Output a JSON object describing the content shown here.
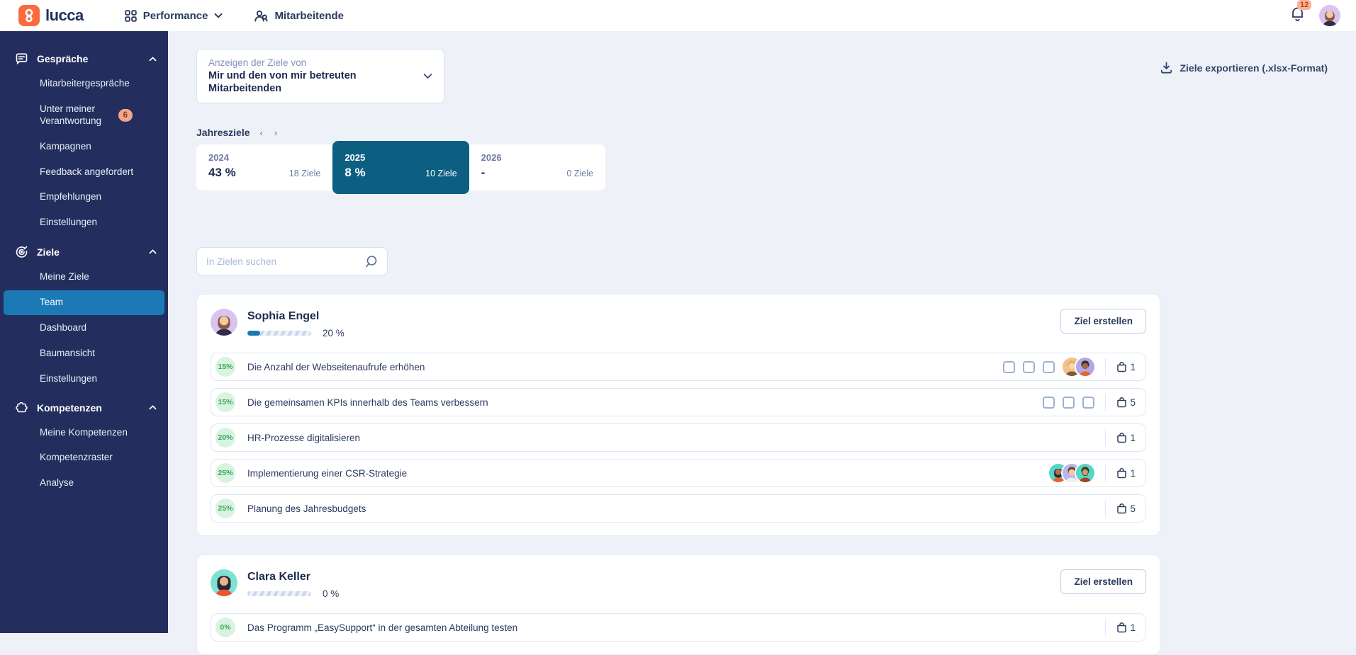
{
  "topbar": {
    "brand": "lucca",
    "app_switcher": "Performance",
    "nav_people": "Mitarbeitende",
    "notifications": "12"
  },
  "sidebar": {
    "sections": [
      {
        "label": "Gespräche",
        "icon": "chat-icon",
        "items": [
          {
            "label": "Mitarbeitergespräche"
          },
          {
            "label": "Unter meiner Verantwortung",
            "badge": "6"
          },
          {
            "label": "Kampagnen"
          },
          {
            "label": "Feedback angefordert"
          },
          {
            "label": "Empfehlungen"
          },
          {
            "label": "Einstellungen"
          }
        ]
      },
      {
        "label": "Ziele",
        "icon": "target-icon",
        "items": [
          {
            "label": "Meine Ziele"
          },
          {
            "label": "Team",
            "selected": true
          },
          {
            "label": "Dashboard"
          },
          {
            "label": "Baumansicht"
          },
          {
            "label": "Einstellungen"
          }
        ]
      },
      {
        "label": "Kompetenzen",
        "icon": "puzzle-icon",
        "items": [
          {
            "label": "Meine Kompetenzen"
          },
          {
            "label": "Kompetenzraster"
          },
          {
            "label": "Analyse"
          }
        ]
      }
    ]
  },
  "filter": {
    "label": "Anzeigen der Ziele von",
    "value": "Mir und den von mir betreuten Mitarbeitenden"
  },
  "export": {
    "label": "Ziele exportieren (.xlsx-Format)"
  },
  "years": {
    "title": "Jahresziele",
    "prev_arrow": "‹",
    "next_arrow": "›",
    "tabs": [
      {
        "year": "2024",
        "percent": "43 %",
        "count": "18 Ziele",
        "selected": false
      },
      {
        "year": "2025",
        "percent": "8 %",
        "count": "10 Ziele",
        "selected": true
      },
      {
        "year": "2026",
        "percent": "-",
        "count": "0 Ziele",
        "selected": false
      }
    ]
  },
  "search": {
    "placeholder": "In Zielen suchen"
  },
  "buttons": {
    "create_goal": "Ziel erstellen"
  },
  "employees": [
    {
      "name": "Sophia Engel",
      "progress_label": "20 %",
      "progress_percent": 20,
      "goals": [
        {
          "weight": "15%",
          "title": "Die Anzahl der Webseitenaufrufe erhöhen",
          "checkboxes": 3,
          "avatars": 2,
          "gift_count": "1"
        },
        {
          "weight": "15%",
          "title": "Die gemeinsamen KPIs innerhalb des Teams verbessern",
          "checkboxes": 3,
          "avatars": 0,
          "gift_count": "5"
        },
        {
          "weight": "20%",
          "title": "HR-Prozesse digitalisieren",
          "checkboxes": 0,
          "avatars": 0,
          "gift_count": "1"
        },
        {
          "weight": "25%",
          "title": "Implementierung einer CSR-Strategie",
          "checkboxes": 0,
          "avatars": 3,
          "gift_count": "1"
        },
        {
          "weight": "25%",
          "title": "Planung des Jahresbudgets",
          "checkboxes": 0,
          "avatars": 0,
          "gift_count": "5"
        }
      ]
    },
    {
      "name": "Clara Keller",
      "progress_label": "0 %",
      "progress_percent": 0,
      "goals": [
        {
          "weight": "0%",
          "title": "Das Programm „EasySupport“ in der gesamten Abteilung testen",
          "checkboxes": 0,
          "avatars": 0,
          "gift_count": "1"
        }
      ]
    }
  ],
  "colors": {
    "brand_orange": "#f96b3d",
    "sidebar_bg": "#242e5e",
    "accent_blue": "#1b79b5",
    "selected_year_bg": "#0d5f82",
    "goal_badge_green": "#3aa55c",
    "notification_badge": "#f9b29c"
  }
}
